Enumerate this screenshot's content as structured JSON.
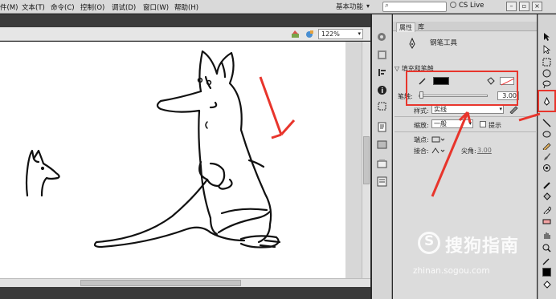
{
  "menubar": {
    "items": [
      {
        "label": "件(M)"
      },
      {
        "label": "文本(T)"
      },
      {
        "label": "命令(C)"
      },
      {
        "label": "控制(O)"
      },
      {
        "label": "调试(D)"
      },
      {
        "label": "窗口(W)"
      },
      {
        "label": "帮助(H)"
      }
    ],
    "workspace": "基本功能",
    "search_placeholder": "",
    "cs_live": "CS Live"
  },
  "stage": {
    "zoom": "122%"
  },
  "properties": {
    "tabs": [
      "属性",
      "库"
    ],
    "tool_name": "钢笔工具",
    "section_title": "填充和笔触",
    "stroke_label": "笔触:",
    "stroke_value": "3.00",
    "style_label": "样式:",
    "style_value": "实线",
    "scale_label": "缩放:",
    "scale_value": "一般",
    "hint_label": "提示",
    "cap_label": "端点:",
    "join_label": "接合:",
    "miter_label": "尖角:",
    "miter_value": "3.00"
  },
  "colors": {
    "stroke_color": "#000000",
    "annotation": "#e8352c"
  },
  "watermark": {
    "brand": "搜狗指南",
    "url": "zhinan.sogou.com"
  }
}
